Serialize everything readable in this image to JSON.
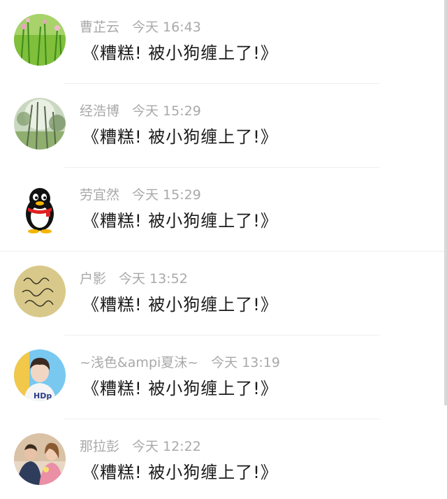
{
  "comments": [
    {
      "name": "曹芷云",
      "time": "今天 16:43",
      "text": "《糟糕! 被小狗缠上了!》",
      "avatar_icon": "grass-flowers-avatar"
    },
    {
      "name": "经浩博",
      "time": "今天 15:29",
      "text": "《糟糕! 被小狗缠上了!》",
      "avatar_icon": "forest-trees-avatar"
    },
    {
      "name": "劳宜然",
      "time": "今天 15:29",
      "text": "《糟糕! 被小狗缠上了!》",
      "avatar_icon": "qq-penguin-avatar"
    },
    {
      "name": "户影",
      "time": "今天 13:52",
      "text": "《糟糕! 被小狗缠上了!》",
      "avatar_icon": "handwriting-avatar"
    },
    {
      "name": "~浅色&ampi夏沫~",
      "time": "今天 13:19",
      "text": "《糟糕! 被小狗缠上了!》",
      "avatar_icon": "boy-photo-avatar"
    },
    {
      "name": "那拉彭",
      "time": "今天 12:22",
      "text": "《糟糕! 被小狗缠上了!》",
      "avatar_icon": "couple-photo-avatar"
    }
  ],
  "colors": {
    "name_time": "#a9a9a9",
    "comment_text": "#1a1a1a",
    "divider": "#efefef",
    "scrollbar": "#d9d9d9"
  }
}
